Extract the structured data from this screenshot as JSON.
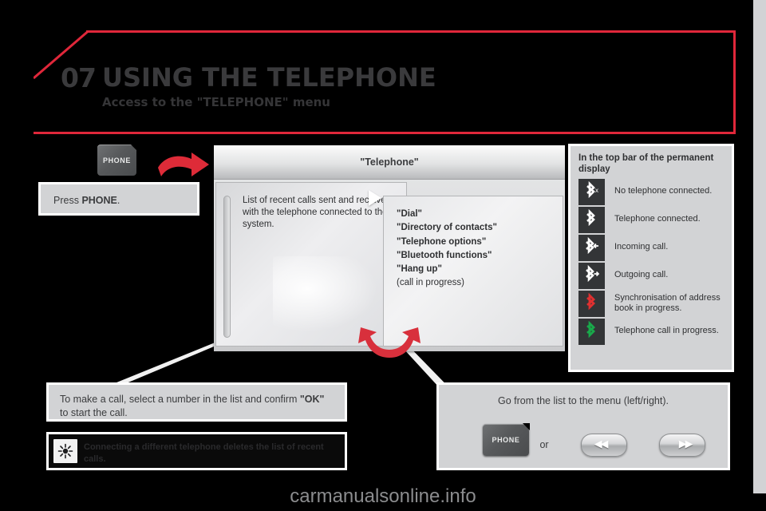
{
  "header": {
    "chapter_number": "07",
    "title": "USING THE TELEPHONE",
    "subtitle": "Access to the \"TELEPHONE\" menu"
  },
  "press_phone": {
    "text_before": "Press ",
    "text_bold": "PHONE",
    "text_after": "."
  },
  "hardware_buttons": {
    "phone_label": "PHONE",
    "seek_prev_glyph": "◀◀",
    "seek_next_glyph": "▶▶"
  },
  "screen": {
    "title": "\"Telephone\"",
    "left_pane_text": "List of recent calls sent and received with the telephone connected to the system.",
    "menu_items": [
      {
        "label": "\"Dial\"",
        "bold": true
      },
      {
        "label": "\"Directory of contacts\"",
        "bold": true
      },
      {
        "label": "\"Telephone options\"",
        "bold": true
      },
      {
        "label": "\"Bluetooth functions\"",
        "bold": true
      },
      {
        "label": "\"Hang up\"",
        "bold": true
      },
      {
        "label": "(call in progress)",
        "bold": false
      }
    ]
  },
  "make_call": {
    "line1_a": "To make a call, select a number in the list and confirm ",
    "line1_bold": "\"OK\"",
    "line2": "to start the call."
  },
  "note": {
    "icon": "tip-sun-icon",
    "text": "Connecting a different telephone deletes the list of recent calls."
  },
  "go_from_list": {
    "title": "Go from the list to the menu (left/right).",
    "or_label": "or"
  },
  "legend": {
    "title": "In the top bar of the permanent display",
    "rows": [
      {
        "icon": "bluetooth-disconnected-icon",
        "color": "#ffffff",
        "badge": "x",
        "label": "No telephone connected."
      },
      {
        "icon": "bluetooth-connected-icon",
        "color": "#ffffff",
        "badge": "",
        "label": "Telephone connected."
      },
      {
        "icon": "bluetooth-incoming-call-icon",
        "color": "#ffffff",
        "badge": "←",
        "label": "Incoming call."
      },
      {
        "icon": "bluetooth-outgoing-call-icon",
        "color": "#ffffff",
        "badge": "→",
        "label": "Outgoing call."
      },
      {
        "icon": "bluetooth-sync-icon",
        "color": "#e03030",
        "badge": "",
        "label": "Synchronisation of address book in progress."
      },
      {
        "icon": "bluetooth-call-active-icon",
        "color": "#19a94a",
        "badge": "",
        "label": "Telephone call in progress."
      }
    ]
  },
  "watermark": {
    "text": "carmanualsonline.info"
  },
  "colors": {
    "accent_red": "#e0273a",
    "panel_gray": "#d2d3d5",
    "text_dark": "#3b3c3e",
    "tile_dark": "#333537",
    "sync_red": "#e03030",
    "call_green": "#19a94a"
  }
}
